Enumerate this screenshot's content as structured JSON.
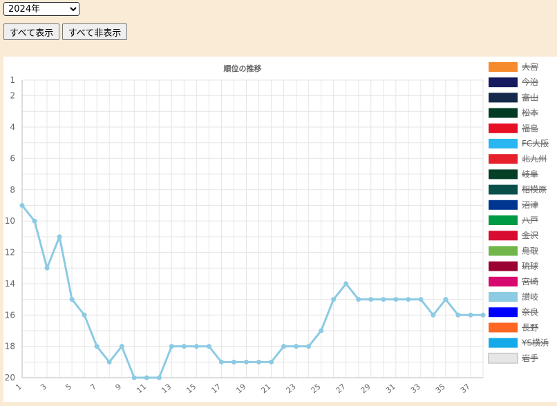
{
  "controls": {
    "year_selected": "2024年",
    "year_options": [
      "2024年"
    ],
    "show_all_label": "すべて表示",
    "hide_all_label": "すべて非表示"
  },
  "chart_data": {
    "type": "line",
    "title": "順位の推移",
    "xlabel": "",
    "ylabel": "",
    "x_ticks": [
      1,
      3,
      5,
      7,
      9,
      11,
      13,
      15,
      17,
      19,
      21,
      23,
      25,
      27,
      29,
      31,
      33,
      35,
      37
    ],
    "xlim": [
      1,
      38
    ],
    "y_ticks": [
      1,
      2,
      4,
      6,
      8,
      10,
      12,
      14,
      16,
      18,
      20
    ],
    "ylim": [
      1,
      20
    ],
    "y_reversed": true,
    "grid": true,
    "legend_position": "right",
    "legend": [
      {
        "name": "大宮",
        "color": "#f68b2c",
        "hidden": true
      },
      {
        "name": "今治",
        "color": "#161a5e",
        "hidden": true
      },
      {
        "name": "富山",
        "color": "#16294a",
        "hidden": true
      },
      {
        "name": "松本",
        "color": "#003b22",
        "hidden": true
      },
      {
        "name": "福島",
        "color": "#e60f24",
        "hidden": true
      },
      {
        "name": "FC大阪",
        "color": "#29b6f1",
        "hidden": true
      },
      {
        "name": "北九州",
        "color": "#e6212c",
        "hidden": true
      },
      {
        "name": "岐阜",
        "color": "#053f26",
        "hidden": true
      },
      {
        "name": "相模原",
        "color": "#0b4f4a",
        "hidden": true
      },
      {
        "name": "沼津",
        "color": "#003591",
        "hidden": true
      },
      {
        "name": "八戸",
        "color": "#009944",
        "hidden": true
      },
      {
        "name": "金沢",
        "color": "#d80c33",
        "hidden": true
      },
      {
        "name": "鳥取",
        "color": "#71b64a",
        "hidden": true
      },
      {
        "name": "琉球",
        "color": "#9b0033",
        "hidden": true
      },
      {
        "name": "宮崎",
        "color": "#d7096f",
        "hidden": true
      },
      {
        "name": "讃岐",
        "color": "#8dcae3",
        "hidden": false
      },
      {
        "name": "奈良",
        "color": "#0000ff",
        "hidden": true
      },
      {
        "name": "長野",
        "color": "#ff6623",
        "hidden": true
      },
      {
        "name": "YS横浜",
        "color": "#14a9e8",
        "hidden": true
      },
      {
        "name": "岩手",
        "color": "#e6e6e6",
        "hidden": true
      }
    ],
    "series": [
      {
        "name": "讃岐",
        "color": "#8dcae3",
        "x": [
          1,
          2,
          3,
          4,
          5,
          6,
          7,
          8,
          9,
          10,
          11,
          12,
          13,
          14,
          15,
          16,
          17,
          18,
          19,
          20,
          21,
          22,
          23,
          24,
          25,
          26,
          27,
          28,
          29,
          30,
          31,
          32,
          33,
          34,
          35,
          36,
          37,
          38
        ],
        "values": [
          9,
          10,
          13,
          11,
          15,
          16,
          18,
          19,
          18,
          20,
          20,
          20,
          18,
          18,
          18,
          18,
          19,
          19,
          19,
          19,
          19,
          18,
          18,
          18,
          17,
          15,
          14,
          15,
          15,
          15,
          15,
          15,
          15,
          16,
          15,
          16,
          16,
          16
        ]
      }
    ]
  }
}
